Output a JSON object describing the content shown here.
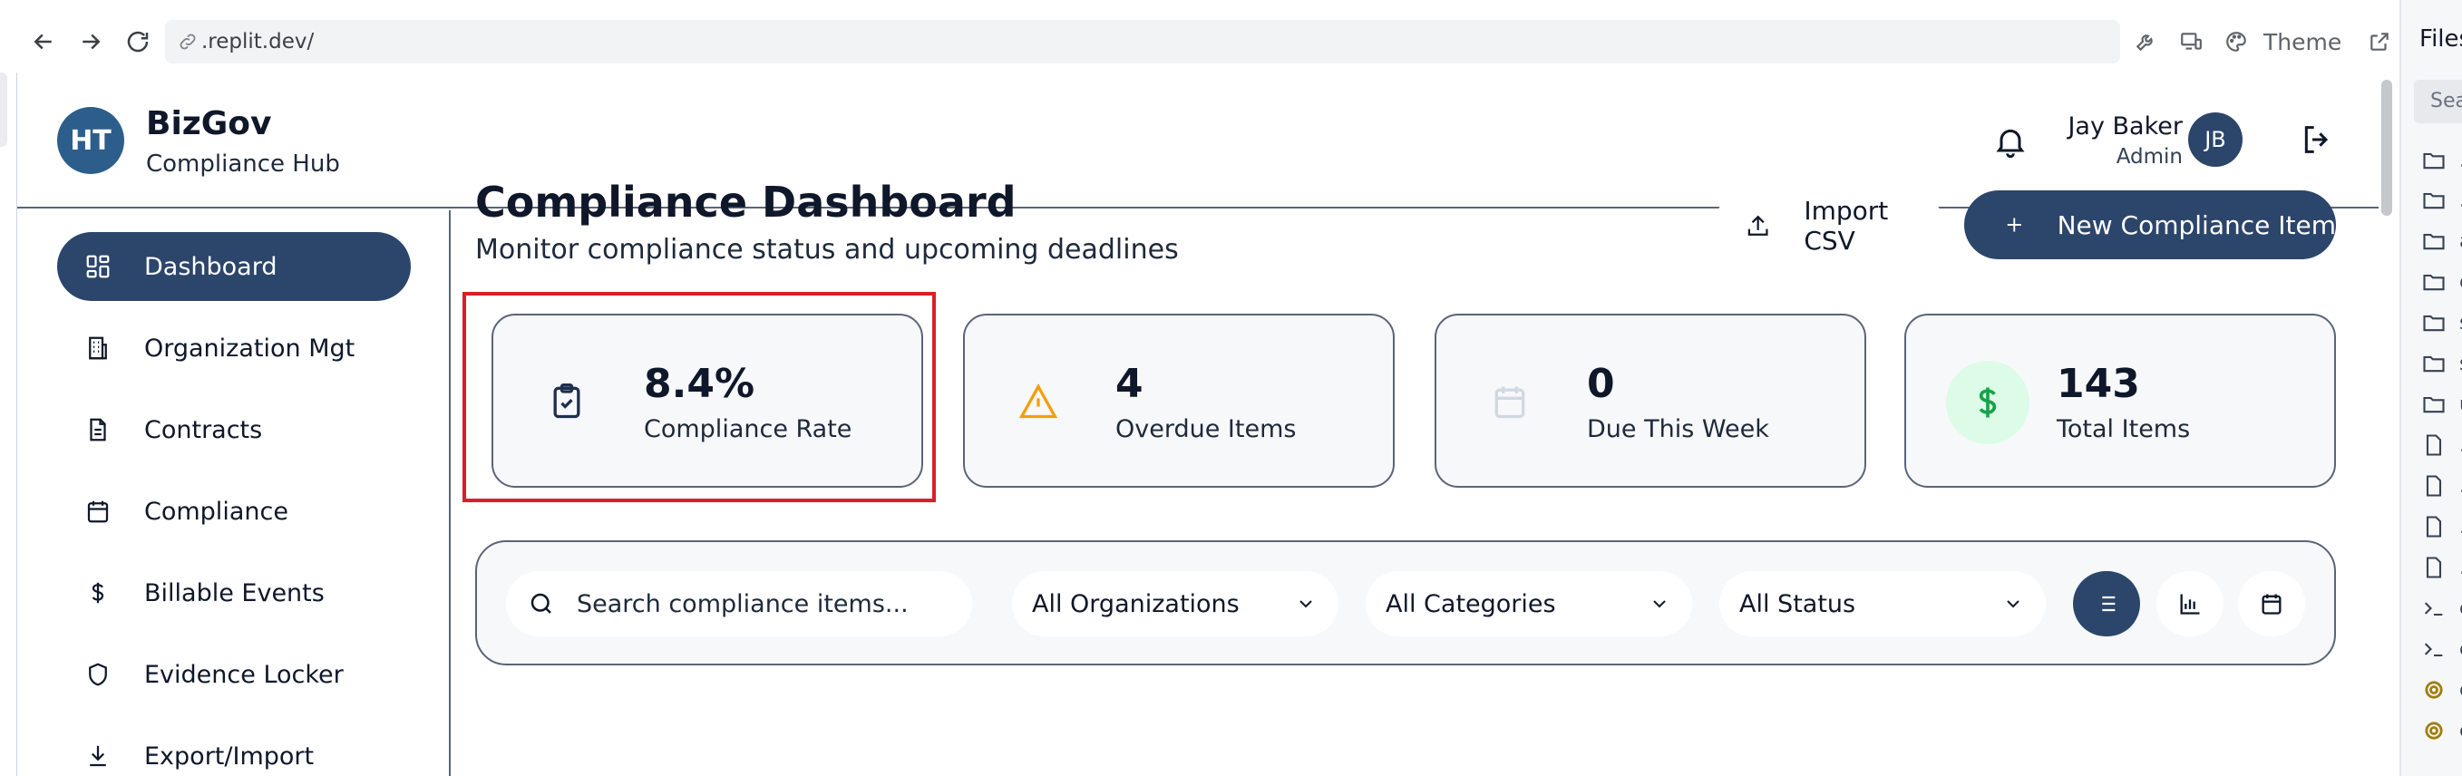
{
  "browser": {
    "url": ".replit.dev/",
    "theme_label": "Theme"
  },
  "file_panel": {
    "title": "Files",
    "search_placeholder": "Search",
    "rows": [
      {
        "type": "folder",
        "label": "."
      },
      {
        "type": "folder",
        "label": "."
      },
      {
        "type": "folder",
        "label": "a"
      },
      {
        "type": "folder",
        "label": "c"
      },
      {
        "type": "folder",
        "label": "s"
      },
      {
        "type": "folder",
        "label": "s"
      },
      {
        "type": "folder",
        "label": "u"
      },
      {
        "type": "file",
        "label": "."
      },
      {
        "type": "file",
        "label": "."
      },
      {
        "type": "file",
        "label": "."
      },
      {
        "type": "file",
        "label": "."
      },
      {
        "type": "shell",
        "label": "c"
      },
      {
        "type": "shell",
        "label": "c"
      },
      {
        "type": "config",
        "label": "c"
      },
      {
        "type": "config",
        "label": "c"
      }
    ]
  },
  "header": {
    "logo_initials": "HT",
    "brand_name": "BizGov",
    "brand_sub": "Compliance Hub",
    "user_name": "Jay Baker",
    "user_role": "Admin",
    "user_initials": "JB"
  },
  "sidebar": {
    "items": [
      {
        "label": "Dashboard",
        "icon": "dashboard-icon",
        "active": true
      },
      {
        "label": "Organization Mgt",
        "icon": "building-icon",
        "active": false
      },
      {
        "label": "Contracts",
        "icon": "document-icon",
        "active": false
      },
      {
        "label": "Compliance",
        "icon": "calendar-icon",
        "active": false
      },
      {
        "label": "Billable Events",
        "icon": "dollar-icon",
        "active": false
      },
      {
        "label": "Evidence Locker",
        "icon": "shield-icon",
        "active": false
      },
      {
        "label": "Export/Import",
        "icon": "download-icon",
        "active": false
      }
    ]
  },
  "main": {
    "title": "Compliance Dashboard",
    "subtitle": "Monitor compliance status and upcoming deadlines",
    "import_label": "Import CSV",
    "new_item_label": "New Compliance Item",
    "stats": [
      {
        "value": "8.4%",
        "label": "Compliance Rate",
        "icon": "clipboard-check-icon"
      },
      {
        "value": "4",
        "label": "Overdue Items",
        "icon": "warning-icon"
      },
      {
        "value": "0",
        "label": "Due This Week",
        "icon": "calendar-icon"
      },
      {
        "value": "143",
        "label": "Total Items",
        "icon": "dollar-icon"
      }
    ],
    "filters": {
      "search_placeholder": "Search compliance items...",
      "organization": "All Organizations",
      "category": "All Categories",
      "status": "All Status"
    }
  },
  "colors": {
    "primary": "#2c456b",
    "logo": "#2d5d8b",
    "highlight": "#d92026",
    "warning": "#f59e0b",
    "success": "#16a34a"
  }
}
